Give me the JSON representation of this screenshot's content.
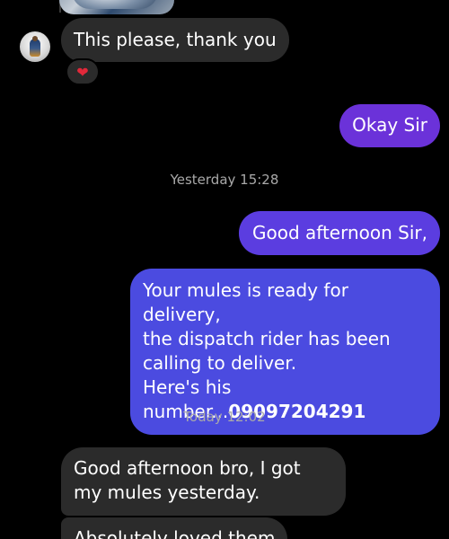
{
  "conversation": {
    "messages": [
      {
        "direction": "incoming",
        "text": "This please, thank you",
        "reaction": "❤"
      },
      {
        "direction": "outgoing",
        "text": "Okay Sir"
      },
      {
        "direction": "outgoing",
        "text": "Good afternoon Sir,"
      },
      {
        "direction": "outgoing",
        "text_lines": [
          "Your mules is ready for delivery,",
          "the dispatch rider has been",
          "calling to deliver.",
          "Here's his number..."
        ],
        "phone_number": "09097204291"
      },
      {
        "direction": "incoming",
        "text": "Good afternoon bro, I got my mules yesterday."
      },
      {
        "direction": "incoming",
        "text": "Absolutely loved them"
      }
    ],
    "timestamps": [
      "Yesterday 15:28",
      "Today 12:02"
    ]
  },
  "colors": {
    "background": "#000000",
    "incoming_bubble": "#2b2b2b",
    "outgoing_bubble": "#6b32d9",
    "outgoing_bubble_gradient": "#4b4be0",
    "timestamp_text": "#a9a9a9",
    "reaction_heart": "#e2283a"
  }
}
